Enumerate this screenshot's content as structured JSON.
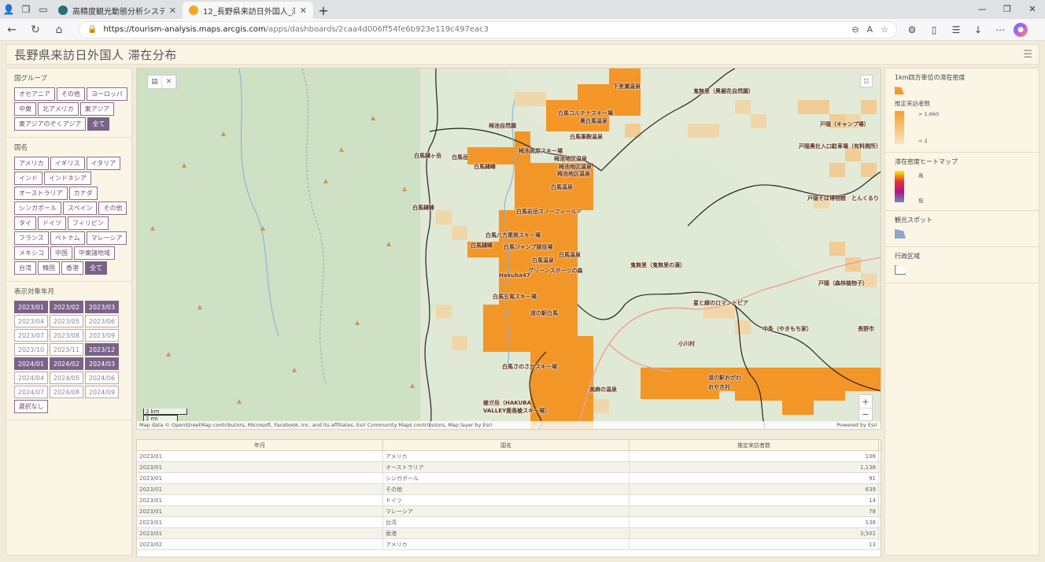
{
  "browser": {
    "tabs": [
      {
        "title": "高精度観光動態分析システム",
        "active": false
      },
      {
        "title": "12_長野県来訪日外国人_滞在分",
        "active": true
      }
    ],
    "url_host": "https://tourism-analysis.maps.arcgis.com",
    "url_path": "/apps/dashboards/2caa4d006ff54fe6b923e119c497eac3"
  },
  "dashboard": {
    "title": "長野県来訪日外国人 滞在分布"
  },
  "filters": {
    "group": {
      "title": "国グループ",
      "options": [
        "オセアニア",
        "その他",
        "ヨーロッパ",
        "中東",
        "北アメリカ",
        "東アジア",
        "東アジアのぞくアジア",
        "全て"
      ],
      "selected": "全て"
    },
    "country": {
      "title": "国名",
      "options": [
        "アメリカ",
        "イギリス",
        "イタリア",
        "インド",
        "インドネシア",
        "オーストラリア",
        "カナダ",
        "シンガポール",
        "スペイン",
        "その他",
        "タイ",
        "ドイツ",
        "フィリピン",
        "フランス",
        "ベトナム",
        "マレーシア",
        "メキシコ",
        "中国",
        "中東諸地域",
        "台湾",
        "韓国",
        "香港",
        "全て"
      ],
      "selected": "全て"
    },
    "month": {
      "title": "表示対象年月",
      "options": [
        "2023/01",
        "2023/02",
        "2023/03",
        "2023/04",
        "2023/05",
        "2023/06",
        "2023/07",
        "2023/08",
        "2023/09",
        "2023/10",
        "2023/11",
        "2023/12",
        "2024/01",
        "2024/02",
        "2024/03",
        "2024/04",
        "2024/05",
        "2024/06",
        "2024/07",
        "2024/08",
        "2024/09"
      ],
      "selected": [
        "2023/01",
        "2023/02",
        "2023/03",
        "2023/12",
        "2024/01",
        "2024/02",
        "2024/03"
      ],
      "none_label": "選択なし"
    }
  },
  "map": {
    "labels": [
      {
        "text": "下里瀬温泉"
      },
      {
        "text": "鬼無里（奥裾花自然園）"
      },
      {
        "text": "白馬コルチナスキー場"
      },
      {
        "text": "栂池自然園"
      },
      {
        "text": "奥白馬温泉"
      },
      {
        "text": "白馬乗鞍温泉"
      },
      {
        "text": "戸隠（キャンプ場）"
      },
      {
        "text": "白馬鑓ヶ岳"
      },
      {
        "text": "白馬岳"
      },
      {
        "text": "白馬鑓峰"
      },
      {
        "text": "栂池高原スキー場"
      },
      {
        "text": "栂池地区温泉"
      },
      {
        "text": "栂池地区温泉"
      },
      {
        "text": "栂池地区温泉"
      },
      {
        "text": "戸隠奥社入口駐車場（有料関所）"
      },
      {
        "text": "白馬温泉"
      },
      {
        "text": "戸隠そば博物館　とんくるり"
      },
      {
        "text": "白馬鑓峰"
      },
      {
        "text": "白馬岩岳スノーフィールド"
      },
      {
        "text": "白馬八方尾根スキー場"
      },
      {
        "text": "白馬鑓峰"
      },
      {
        "text": "白馬ジャンプ競技場"
      },
      {
        "text": "白馬温泉"
      },
      {
        "text": "白馬温泉"
      },
      {
        "text": "鬼無里（鬼無里の湯）"
      },
      {
        "text": "グリーンスポーツの森"
      },
      {
        "text": "Hakuba47"
      },
      {
        "text": "戸隠（森林植物子）"
      },
      {
        "text": "白馬五竜スキー場"
      },
      {
        "text": "星と緑のロマントピア"
      },
      {
        "text": "道の駅白馬"
      },
      {
        "text": "中条（やきもち家）"
      },
      {
        "text": "長野市"
      },
      {
        "text": "小川村"
      },
      {
        "text": "白馬さのさかスキー場"
      },
      {
        "text": "道の駅おがわ"
      },
      {
        "text": "おやき村"
      },
      {
        "text": "美麻の温泉"
      },
      {
        "text": "爺ガ岳（HAKUBA VALLEY鹿島槍スキー場）"
      }
    ],
    "scale": [
      "2 km",
      "2 mi"
    ],
    "attribution": "Map data © OpenStreetMap contributors, Microsoft, Facebook, Inc. and its affiliates, Esri Community Maps contributors, Map layer by Esri",
    "powered": "Powered by Esri"
  },
  "table": {
    "headers": [
      "年月",
      "国名",
      "推定来訪者数"
    ],
    "rows": [
      [
        "2023/01",
        "アメリカ",
        "106"
      ],
      [
        "2023/01",
        "オーストラリア",
        "1,138"
      ],
      [
        "2023/01",
        "シンガポール",
        "91"
      ],
      [
        "2023/01",
        "その他",
        "639"
      ],
      [
        "2023/01",
        "ドイツ",
        "14"
      ],
      [
        "2023/01",
        "マレーシア",
        "78"
      ],
      [
        "2023/01",
        "台湾",
        "138"
      ],
      [
        "2023/01",
        "香港",
        "3,501"
      ],
      [
        "2023/02",
        "アメリカ",
        "13"
      ]
    ]
  },
  "legend": {
    "grid_title": "1km四方単位の滞在密度",
    "estimate_label": "推定来訪者数",
    "max_label": "> 1,660",
    "min_label": "< 2",
    "heat_title": "滞在密度ヒートマップ",
    "heat_high": "高",
    "heat_low": "低",
    "spot_title": "観光スポット",
    "admin_title": "行政区域",
    "colors": {
      "grid": "#f59a2e",
      "spot": "#8da7c4"
    }
  }
}
